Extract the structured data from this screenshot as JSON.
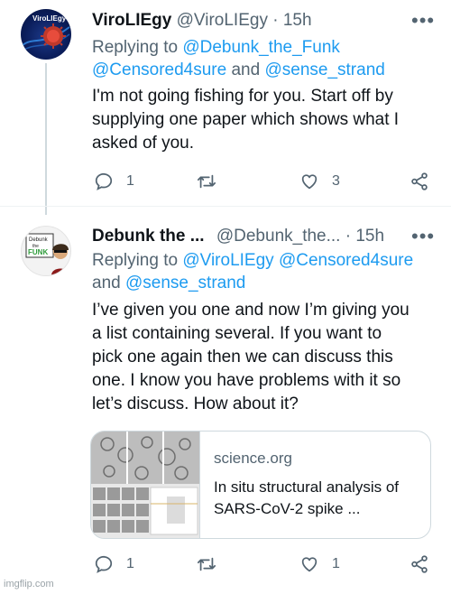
{
  "tweets": [
    {
      "display_name": "ViroLIEgy",
      "handle": "@ViroLIEgy",
      "sep": "·",
      "time": "15h",
      "more": "•••",
      "avatar_text": "ViroLIEgy",
      "replying_prefix": "Replying to",
      "mention_a": "@Debunk_the_Funk",
      "mention_b": "@Censored4sure",
      "joiner": "and",
      "mention_c": "@sense_strand",
      "body": [
        "I'm not going fishing for you. Start off by",
        "supplying one paper which shows what I",
        "asked of you."
      ],
      "counts": {
        "reply": "1",
        "retweet": "",
        "like": "3"
      }
    },
    {
      "display_name": "Debunk the ...",
      "handle": "@Debunk_the...",
      "sep": "·",
      "time": "15h",
      "more": "•••",
      "avatar_text": "Debunk the Funk",
      "replying_prefix": "Replying to",
      "mention_a": "@ViroLIEgy",
      "mention_b": "@Censored4sure",
      "joiner": "and",
      "mention_c": "@sense_strand",
      "body": [
        "I’ve given you one and now I’m giving you",
        "a list containing several. If you want to",
        "pick one again then we can discuss this",
        "one. I know you have problems with it so",
        "let’s discuss. How about it?"
      ],
      "card": {
        "domain": "science.org",
        "title": "In situ structural analysis of SARS-CoV-2 spike ..."
      },
      "counts": {
        "reply": "1",
        "retweet": "",
        "like": "1"
      }
    }
  ],
  "watermark": "imgflip.com",
  "colors": {
    "accent": "#1d9bf0",
    "muted": "#536471",
    "text": "#0f1419",
    "border": "#cfd9de"
  },
  "icons": [
    "reply-icon",
    "retweet-icon",
    "like-icon",
    "share-icon",
    "more-icon"
  ]
}
